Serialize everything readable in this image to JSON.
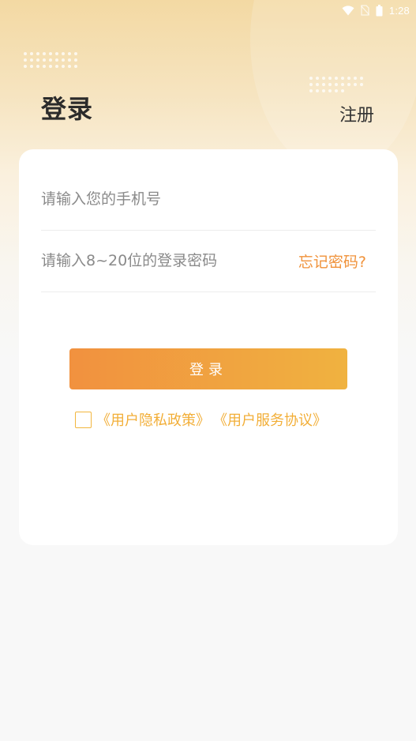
{
  "status_bar": {
    "time": "1:28",
    "icons": [
      "wifi-icon",
      "no-sim-icon",
      "battery-icon"
    ]
  },
  "header": {
    "title": "登录",
    "register_label": "注册"
  },
  "form": {
    "phone_placeholder": "请输入您的手机号",
    "phone_value": "",
    "password_placeholder": "请输入8~20位的登录密码",
    "password_value": "",
    "forgot_label": "忘记密码?",
    "login_label": "登录",
    "agreement_checked": false,
    "privacy_policy_label": "《用户隐私政策》",
    "service_agreement_label": "《用户服务协议》"
  },
  "colors": {
    "accent": "#f0923a",
    "button_start": "#f1913f",
    "button_end": "#f0b240",
    "link": "#f2ae37"
  }
}
